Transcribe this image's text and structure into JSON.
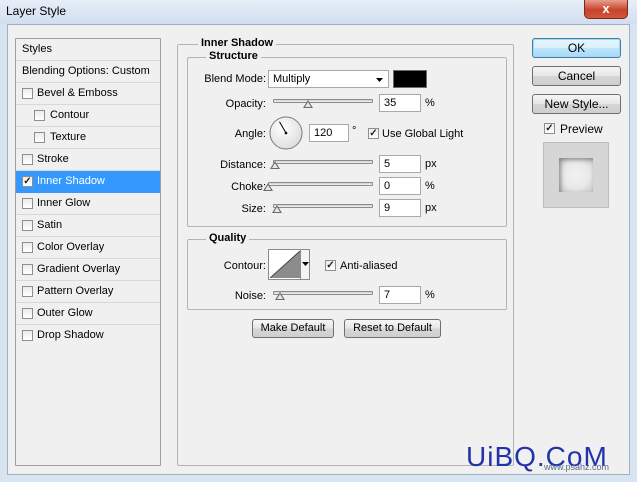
{
  "window": {
    "title": "Layer Style",
    "close_glyph": "x"
  },
  "sidebar": {
    "items": [
      {
        "label": "Styles"
      },
      {
        "label": "Blending Options: Custom"
      },
      {
        "label": "Bevel & Emboss",
        "checked": false
      },
      {
        "label": "Contour",
        "checked": false
      },
      {
        "label": "Texture",
        "checked": false
      },
      {
        "label": "Stroke",
        "checked": false
      },
      {
        "label": "Inner Shadow",
        "checked": true,
        "selected": true
      },
      {
        "label": "Inner Glow",
        "checked": false
      },
      {
        "label": "Satin",
        "checked": false
      },
      {
        "label": "Color Overlay",
        "checked": false
      },
      {
        "label": "Gradient Overlay",
        "checked": false
      },
      {
        "label": "Pattern Overlay",
        "checked": false
      },
      {
        "label": "Outer Glow",
        "checked": false
      },
      {
        "label": "Drop Shadow",
        "checked": false
      }
    ]
  },
  "inner_shadow": {
    "title": "Inner Shadow",
    "structure": {
      "title": "Structure",
      "blend_mode": {
        "label": "Blend Mode:",
        "value": "Multiply",
        "color": "#000000"
      },
      "opacity": {
        "label": "Opacity:",
        "value": "35",
        "unit": "%",
        "fraction": 0.35
      },
      "angle": {
        "label": "Angle:",
        "value": "120",
        "unit": "°",
        "degrees": 120,
        "use_global_light": {
          "label": "Use Global Light",
          "checked": true
        }
      },
      "distance": {
        "label": "Distance:",
        "value": "5",
        "unit": "px",
        "fraction": 0.02
      },
      "choke": {
        "label": "Choke:",
        "value": "0",
        "unit": "%",
        "fraction": 0.0
      },
      "size": {
        "label": "Size:",
        "value": "9",
        "unit": "px",
        "fraction": 0.04
      }
    },
    "quality": {
      "title": "Quality",
      "contour": {
        "label": "Contour:",
        "anti_aliased": {
          "label": "Anti-aliased",
          "checked": true
        }
      },
      "noise": {
        "label": "Noise:",
        "value": "7",
        "unit": "%",
        "fraction": 0.07
      }
    },
    "make_default_label": "Make Default",
    "reset_default_label": "Reset to Default"
  },
  "actions": {
    "ok_label": "OK",
    "cancel_label": "Cancel",
    "new_style_label": "New Style...",
    "preview": {
      "label": "Preview",
      "checked": true
    }
  },
  "watermark": {
    "logo": "UiBQ.CoM",
    "url": "www.psahz.com"
  },
  "colors": {
    "selection": "#3399ff",
    "dialog_bg": "#f0f0f0",
    "title_bar": "#d2def0"
  },
  "checkmark_glyph": "✓"
}
